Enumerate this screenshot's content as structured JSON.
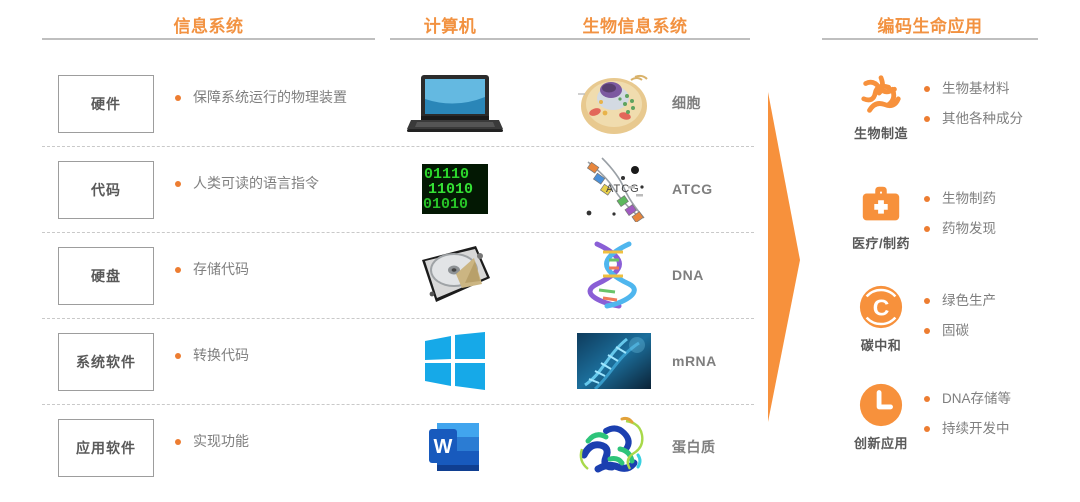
{
  "headers": [
    {
      "label": "信息系统",
      "color": "#F29241"
    },
    {
      "label": "计算机",
      "color": "#F29241"
    },
    {
      "label": "生物信息系统",
      "color": "#F29241"
    },
    {
      "label": "编码生命应用",
      "color": "#F29241"
    }
  ],
  "rows": [
    {
      "tag": "硬件",
      "bullet": "保障系统运行的物理装置",
      "computer_icon": "laptop-icon",
      "bio_icon": "cell-icon",
      "bio_label": "细胞"
    },
    {
      "tag": "代码",
      "bullet": "人类可读的语言指令",
      "computer_icon": "binary-code-icon",
      "bio_icon": "atcg-icon",
      "bio_label": "ATCG"
    },
    {
      "tag": "硬盘",
      "bullet": "存储代码",
      "computer_icon": "hard-disk-icon",
      "bio_icon": "dna-helix-icon",
      "bio_label": "DNA"
    },
    {
      "tag": "系统软件",
      "bullet": "转换代码",
      "computer_icon": "windows-logo-icon",
      "bio_icon": "mrna-icon",
      "bio_label": "mRNA"
    },
    {
      "tag": "应用软件",
      "bullet": "实现功能",
      "computer_icon": "word-logo-icon",
      "bio_icon": "protein-icon",
      "bio_label": "蛋白质"
    }
  ],
  "arrow": {
    "name": "right-arrow-shape",
    "color": "#F7913C"
  },
  "applications": [
    {
      "icon": "bacteria-icon",
      "name": "生物制造",
      "bullets": [
        "生物基材料",
        "其他各种成分"
      ]
    },
    {
      "icon": "medical-kit-icon",
      "name": "医疗/制药",
      "bullets": [
        "生物制药",
        "药物发现"
      ]
    },
    {
      "icon": "carbon-circle-icon",
      "name": "碳中和",
      "bullets": [
        "绿色生产",
        "固碳"
      ]
    },
    {
      "icon": "clock-icon",
      "name": "创新应用",
      "bullets": [
        "DNA存储等",
        "持续开发中"
      ]
    }
  ],
  "theme": {
    "accent": "#ED7D31",
    "header_orange": "#F29241",
    "text_gray": "#7F7F7F",
    "box_border": "#9D9D9D",
    "rule_gray": "#BFBFBF"
  }
}
